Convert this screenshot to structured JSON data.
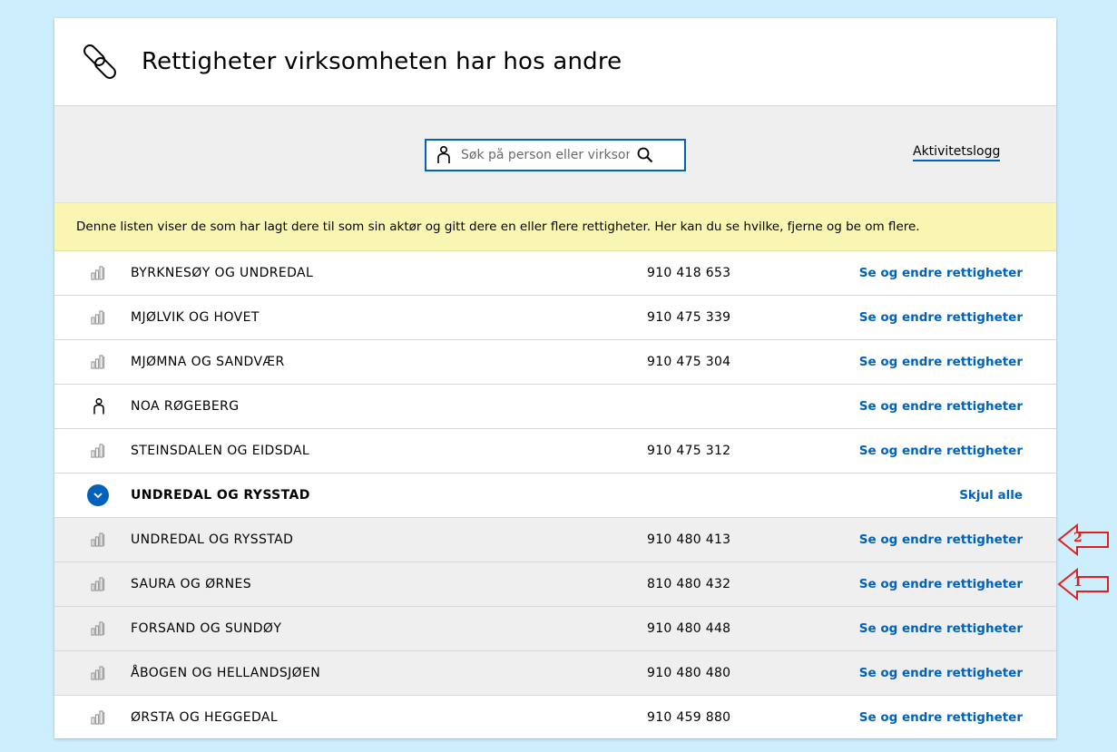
{
  "header": {
    "title": "Rettigheter virksomheten har hos andre"
  },
  "toolbar": {
    "search_placeholder": "Søk på person eller virksom",
    "activity_log_label": "Aktivitetslogg"
  },
  "info_text": "Denne listen viser de som har lagt dere til som sin aktør og gitt dere en eller flere rettigheter. Her kan du se hvilke, fjerne og be om flere.",
  "rows": [
    {
      "type": "org",
      "name": "BYRKNESØY OG UNDREDAL",
      "org_number": "910 418 653",
      "action": "Se og endre rettigheter"
    },
    {
      "type": "org",
      "name": "MJØLVIK OG HOVET",
      "org_number": "910 475 339",
      "action": "Se og endre rettigheter"
    },
    {
      "type": "org",
      "name": "MJØMNA OG SANDVÆR",
      "org_number": "910 475 304",
      "action": "Se og endre rettigheter"
    },
    {
      "type": "person",
      "name": "NOA RØGEBERG",
      "org_number": "",
      "action": "Se og endre rettigheter"
    },
    {
      "type": "org",
      "name": "STEINSDALEN OG EIDSDAL",
      "org_number": "910 475 312",
      "action": "Se og endre rettigheter"
    },
    {
      "type": "group",
      "name": "UNDREDAL OG RYSSTAD",
      "org_number": "",
      "action": "Skjul alle"
    },
    {
      "type": "sub",
      "name": "UNDREDAL OG RYSSTAD",
      "org_number": "910 480 413",
      "action": "Se og endre rettigheter"
    },
    {
      "type": "sub",
      "name": "SAURA OG ØRNES",
      "org_number": "810 480 432",
      "action": "Se og endre rettigheter"
    },
    {
      "type": "sub",
      "name": "FORSAND OG SUNDØY",
      "org_number": "910 480 448",
      "action": "Se og endre rettigheter"
    },
    {
      "type": "sub",
      "name": "ÅBOGEN OG HELLANDSJØEN",
      "org_number": "910 480 480",
      "action": "Se og endre rettigheter"
    },
    {
      "type": "org",
      "name": "ØRSTA OG HEGGEDAL",
      "org_number": "910 459 880",
      "action": "Se og endre rettigheter"
    }
  ],
  "annotations": [
    {
      "label": "2",
      "row_index": 6
    },
    {
      "label": "1",
      "row_index": 7
    }
  ],
  "colors": {
    "accent": "#0062ba",
    "background": "#cdeefd",
    "info_bg": "#f9f6b4",
    "sub_row_bg": "#efefef",
    "annotation": "#e02020"
  }
}
